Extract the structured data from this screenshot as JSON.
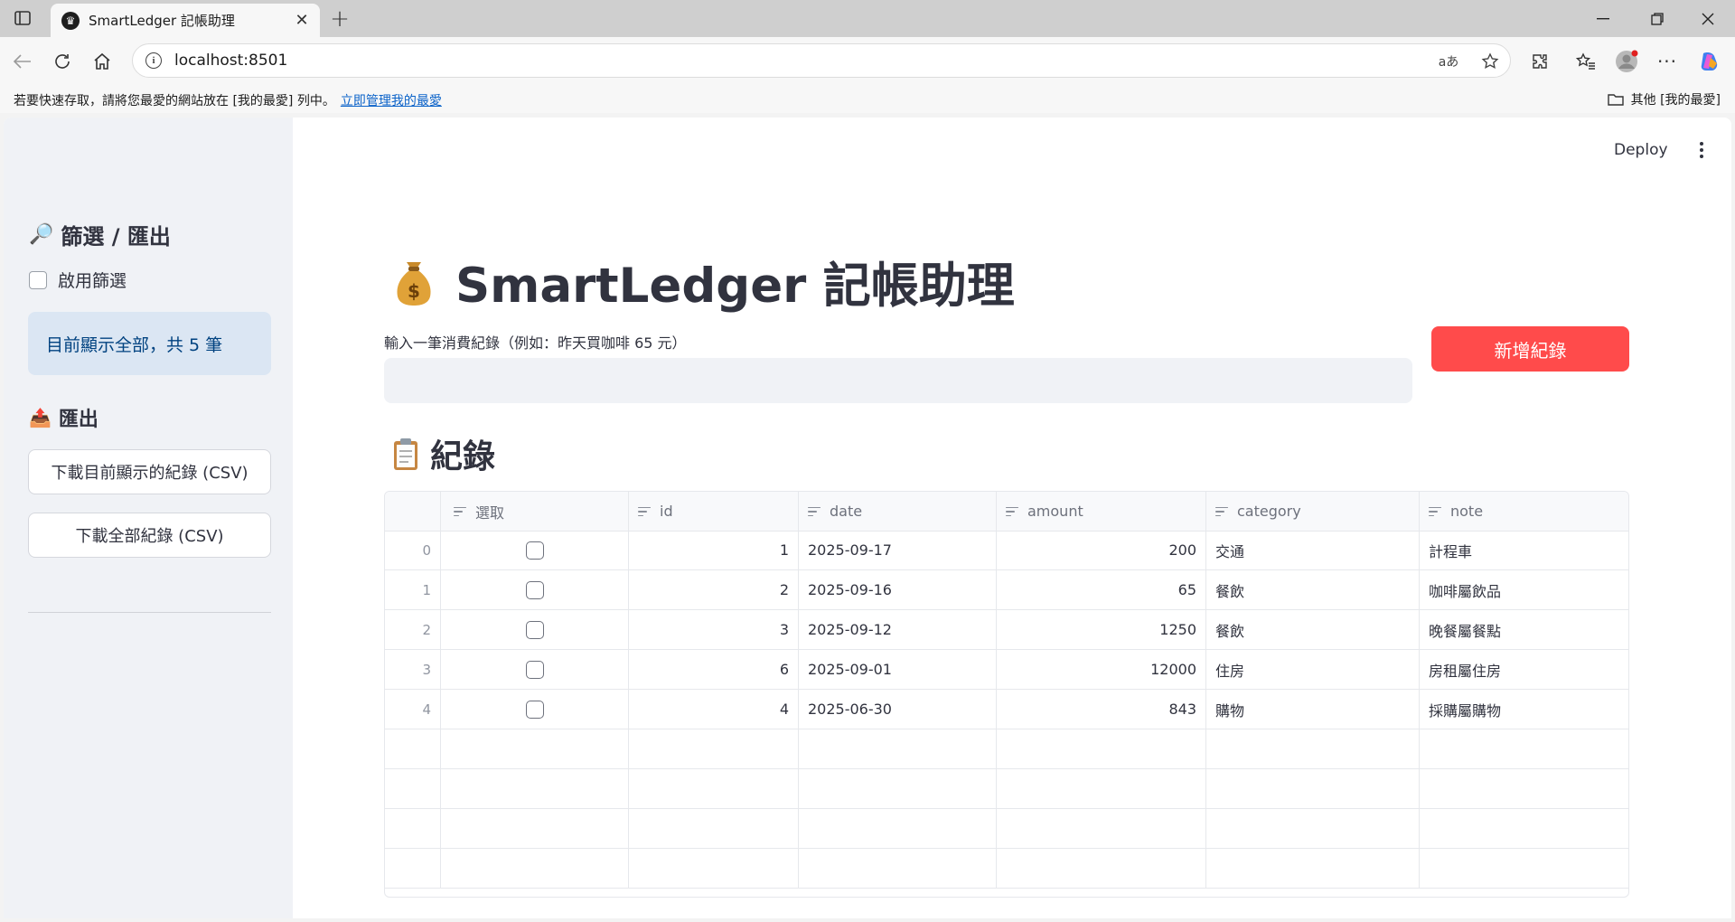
{
  "browser": {
    "tab_title": "SmartLedger 記帳助理",
    "url": "localhost:8501",
    "translate_label": "aあ",
    "favorites_message": "若要快速存取，請將您最愛的網站放在 [我的最愛] 列中。",
    "favorites_link": "立即管理我的最愛",
    "other_favorites": "其他 [我的最愛]"
  },
  "sidebar": {
    "filter_heading": "篩選 / 匯出",
    "filter_emoji": "🔎",
    "enable_filter_label": "啟用篩選",
    "enable_filter_checked": false,
    "info_text": "目前顯示全部，共 5 筆",
    "export_heading": "匯出",
    "export_emoji": "📤",
    "download_current_label": "下載目前顯示的紀錄 (CSV)",
    "download_all_label": "下載全部紀錄 (CSV)"
  },
  "toolbar": {
    "deploy_label": "Deploy"
  },
  "main": {
    "title": "SmartLedger 記帳助理",
    "input_label": "輸入一筆消費紀錄（例如：昨天買咖啡 65 元）",
    "input_value": "",
    "add_button_label": "新增紀錄",
    "records_heading": "紀錄"
  },
  "table": {
    "columns": [
      "選取",
      "id",
      "date",
      "amount",
      "category",
      "note"
    ],
    "rows": [
      {
        "index": "0",
        "selected": false,
        "id": "1",
        "date": "2025-09-17",
        "amount": "200",
        "category": "交通",
        "note": "計程車"
      },
      {
        "index": "1",
        "selected": false,
        "id": "2",
        "date": "2025-09-16",
        "amount": "65",
        "category": "餐飲",
        "note": "咖啡屬飲品"
      },
      {
        "index": "2",
        "selected": false,
        "id": "3",
        "date": "2025-09-12",
        "amount": "1250",
        "category": "餐飲",
        "note": "晚餐屬餐點"
      },
      {
        "index": "3",
        "selected": false,
        "id": "6",
        "date": "2025-09-01",
        "amount": "12000",
        "category": "住房",
        "note": "房租屬住房"
      },
      {
        "index": "4",
        "selected": false,
        "id": "4",
        "date": "2025-06-30",
        "amount": "843",
        "category": "購物",
        "note": "採購屬購物"
      }
    ]
  },
  "colors": {
    "primary_button": "#ff4b4b",
    "sidebar_bg": "#f0f2f6",
    "info_bg": "#dbe6f3",
    "info_text": "#004280",
    "link": "#0a62c9"
  }
}
